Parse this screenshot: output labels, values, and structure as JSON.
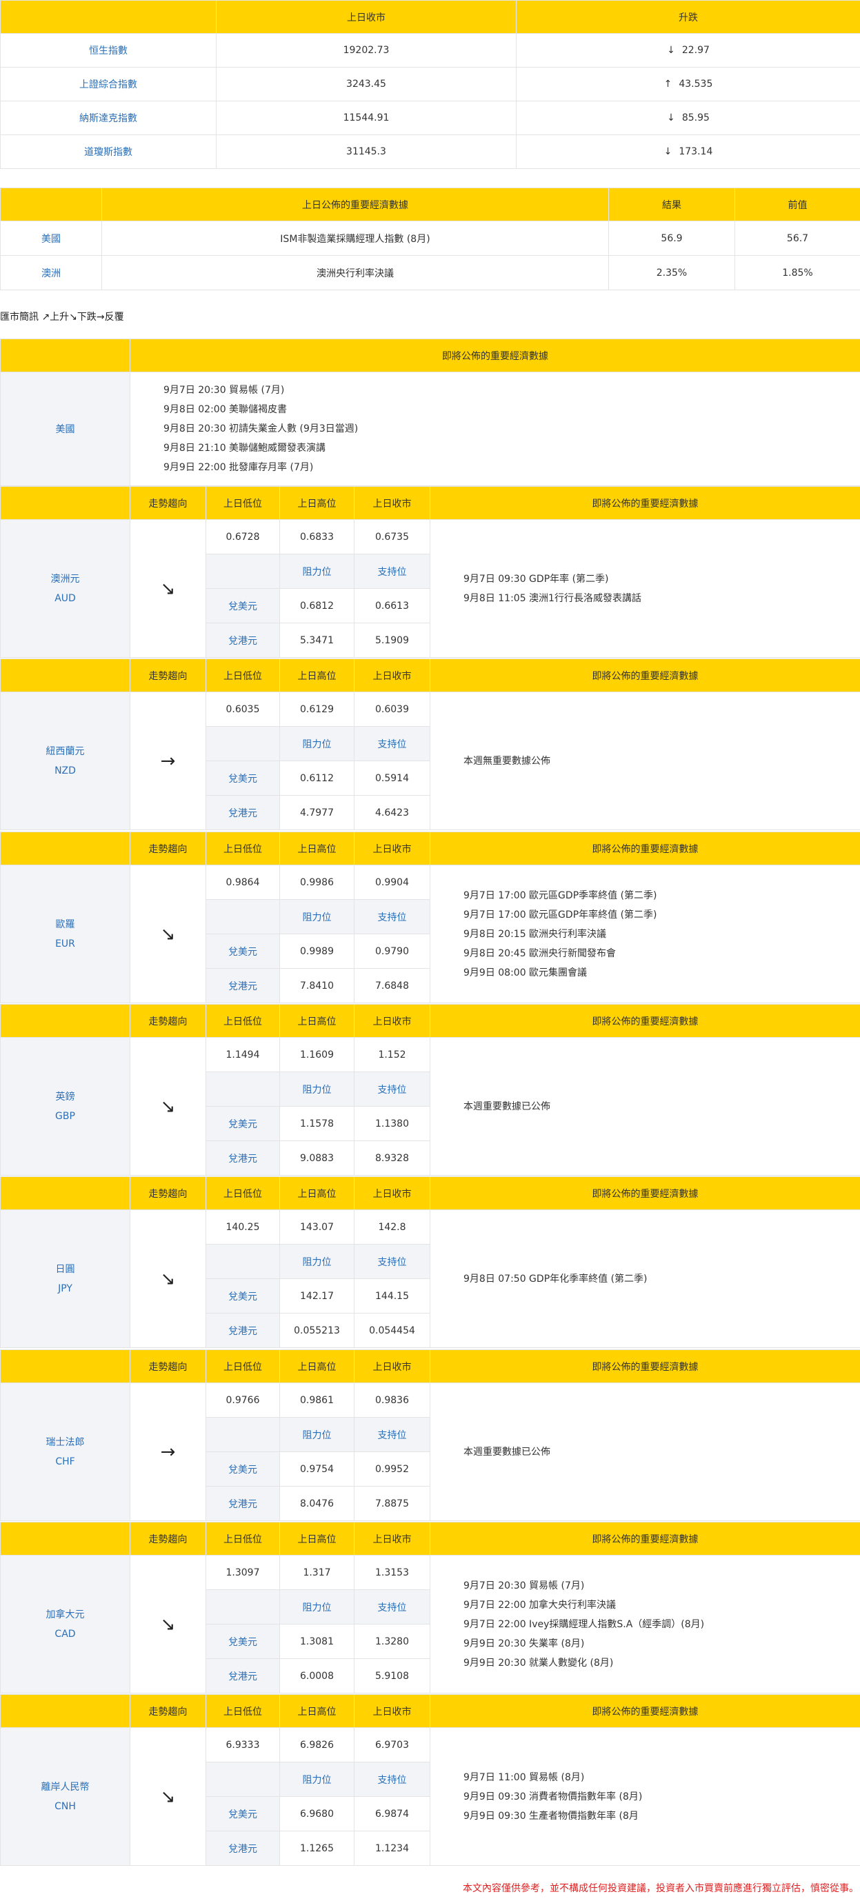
{
  "index_table": {
    "headers": [
      "",
      "上日收市",
      "升跌"
    ],
    "rows": [
      {
        "name": "恒生指數",
        "close": "19202.73",
        "dir": "↓",
        "change": "22.97"
      },
      {
        "name": "上證綜合指數",
        "close": "3243.45",
        "dir": "↑",
        "change": "43.535"
      },
      {
        "name": "納斯達克指數",
        "close": "11544.91",
        "dir": "↓",
        "change": "85.95"
      },
      {
        "name": "道瓊斯指數",
        "close": "31145.3",
        "dir": "↓",
        "change": "173.14"
      }
    ]
  },
  "released_table": {
    "headers": [
      "",
      "上日公佈的重要經濟數據",
      "結果",
      "前值"
    ],
    "rows": [
      {
        "region": "美國",
        "item": "ISM非製造業採購經理人指數 (8月)",
        "result": "56.9",
        "previous": "56.7"
      },
      {
        "region": "澳洲",
        "item": "澳洲央行利率決議",
        "result": "2.35%",
        "previous": "1.85%"
      }
    ]
  },
  "legend": "匯市簡訊 ↗上升↘下跌→反覆",
  "upcoming_us": {
    "header": "即將公佈的重要經濟數據",
    "region": "美國",
    "items": [
      "9月7日 20:30 貿易帳 (7月)",
      "9月8日 02:00 美聯儲褐皮書",
      "9月8日 20:30 初請失業金人數 (9月3日當週)",
      "9月8日 21:10 美聯儲鮑威爾發表演講",
      "9月9日 22:00 批發庫存月率 (7月)"
    ]
  },
  "fx_headers": {
    "trend": "走勢趨向",
    "low": "上日低位",
    "high": "上日高位",
    "close": "上日收市",
    "upcoming": "即將公佈的重要經濟數據",
    "resistance": "阻力位",
    "support": "支持位",
    "vs_usd": "兌美元",
    "vs_hkd": "兌港元"
  },
  "currencies": [
    {
      "name": "澳洲元",
      "code": "AUD",
      "trend": "↘",
      "low": "0.6728",
      "high": "0.6833",
      "close": "0.6735",
      "usd_res": "0.6812",
      "usd_sup": "0.6613",
      "hkd_res": "5.3471",
      "hkd_sup": "5.1909",
      "events": [
        "9月7日 09:30 GDP年率 (第二季)",
        "9月8日 11:05 澳洲1行行長洛威發表講話"
      ]
    },
    {
      "name": "紐西蘭元",
      "code": "NZD",
      "trend": "→",
      "low": "0.6035",
      "high": "0.6129",
      "close": "0.6039",
      "usd_res": "0.6112",
      "usd_sup": "0.5914",
      "hkd_res": "4.7977",
      "hkd_sup": "4.6423",
      "events": [
        "本週無重要數據公佈"
      ]
    },
    {
      "name": "歐羅",
      "code": "EUR",
      "trend": "↘",
      "low": "0.9864",
      "high": "0.9986",
      "close": "0.9904",
      "usd_res": "0.9989",
      "usd_sup": "0.9790",
      "hkd_res": "7.8410",
      "hkd_sup": "7.6848",
      "events": [
        "9月7日 17:00 歐元區GDP季率終值 (第二季)",
        "9月7日 17:00 歐元區GDP年率終值 (第二季)",
        "9月8日 20:15 歐洲央行利率決議",
        "9月8日 20:45 歐洲央行新聞發布會",
        "9月9日 08:00 歐元集團會議"
      ]
    },
    {
      "name": "英鎊",
      "code": "GBP",
      "trend": "↘",
      "low": "1.1494",
      "high": "1.1609",
      "close": "1.152",
      "usd_res": "1.1578",
      "usd_sup": "1.1380",
      "hkd_res": "9.0883",
      "hkd_sup": "8.9328",
      "events": [
        "本週重要數據已公佈"
      ]
    },
    {
      "name": "日圓",
      "code": "JPY",
      "trend": "↘",
      "low": "140.25",
      "high": "143.07",
      "close": "142.8",
      "usd_res": "142.17",
      "usd_sup": "144.15",
      "hkd_res": "0.055213",
      "hkd_sup": "0.054454",
      "events": [
        "9月8日 07:50 GDP年化季率終值 (第二季)"
      ]
    },
    {
      "name": "瑞士法郎",
      "code": "CHF",
      "trend": "→",
      "low": "0.9766",
      "high": "0.9861",
      "close": "0.9836",
      "usd_res": "0.9754",
      "usd_sup": "0.9952",
      "hkd_res": "8.0476",
      "hkd_sup": "7.8875",
      "events": [
        "本週重要數據已公佈"
      ]
    },
    {
      "name": "加拿大元",
      "code": "CAD",
      "trend": "↘",
      "low": "1.3097",
      "high": "1.317",
      "close": "1.3153",
      "usd_res": "1.3081",
      "usd_sup": "1.3280",
      "hkd_res": "6.0008",
      "hkd_sup": "5.9108",
      "events": [
        "9月7日 20:30 貿易帳 (7月)",
        "9月7日 22:00 加拿大央行利率決議",
        "9月7日 22:00 Ivey採購經理人指數S.A（經季調）(8月)",
        "9月9日 20:30 失業率 (8月)",
        "9月9日 20:30 就業人數變化 (8月)"
      ]
    },
    {
      "name": "離岸人民幣",
      "code": "CNH",
      "trend": "↘",
      "low": "6.9333",
      "high": "6.9826",
      "close": "6.9703",
      "usd_res": "6.9680",
      "usd_sup": "6.9874",
      "hkd_res": "1.1265",
      "hkd_sup": "1.1234",
      "events": [
        "9月7日 11:00 貿易帳 (8月)",
        "9月9日 09:30 消費者物價指數年率 (8月)",
        "9月9日 09:30 生產者物價指數年率 (8月"
      ]
    }
  ],
  "disclaimer": "本文內容僅供參考，並不構成任何投資建議，投資者入市買賣前應進行獨立評估，慎密從事。"
}
